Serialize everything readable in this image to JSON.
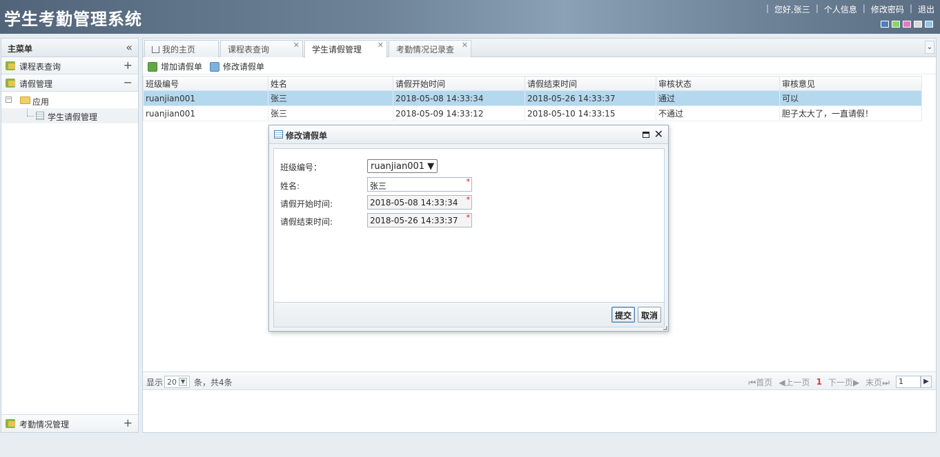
{
  "header": {
    "title": "学生考勤管理系统",
    "links": [
      "您好,张三",
      "个人信息",
      "修改密码",
      "退出"
    ],
    "theme_colors": [
      "#4a7fc1",
      "#8bd36a",
      "#e479c7",
      "#d9d9d9",
      "#8fc6e8"
    ]
  },
  "sidebar": {
    "title": "主菜单",
    "collapse_icon": "«",
    "panels": [
      {
        "label": "课程表查询",
        "tool": "+"
      },
      {
        "label": "请假管理",
        "tool": "−"
      }
    ],
    "tree": {
      "root": "应用",
      "child": "学生请假管理"
    },
    "bottom_panel": {
      "label": "考勤情况管理",
      "tool": "+"
    }
  },
  "tabs": [
    {
      "label": "我的主页",
      "closable": false
    },
    {
      "label": "课程表查询",
      "closable": true
    },
    {
      "label": "学生请假管理",
      "closable": true
    },
    {
      "label": "考勤情况记录查",
      "closable": true
    }
  ],
  "toolbar": {
    "add_label": "增加请假单",
    "edit_label": "修改请假单"
  },
  "grid": {
    "columns": [
      "班级编号",
      "姓名",
      "请假开始时间",
      "请假结束时间",
      "审核状态",
      "审核意见"
    ],
    "rows": [
      [
        "ruanjian001",
        "张三",
        "2018-05-08 14:33:34",
        "2018-05-26 14:33:37",
        "通过",
        "可以"
      ],
      [
        "ruanjian001",
        "张三",
        "2018-05-09 14:33:12",
        "2018-05-10 14:33:15",
        "不通过",
        "胆子太大了，一直请假！"
      ]
    ],
    "selected_row": 0
  },
  "pager": {
    "show_label": "显示",
    "page_size": "20",
    "summary": "条，共4条",
    "first": "首页",
    "prev": "上一页",
    "current": "1",
    "next": "下一页",
    "last": "末页",
    "page_input": "1"
  },
  "dialog": {
    "title": "修改请假单",
    "fields": {
      "class_label": "班级编号：",
      "class_value": "ruanjian001 ▼",
      "name_label": "姓名:",
      "name_value": "张三",
      "start_label": "请假开始时间:",
      "start_value": "2018-05-08 14:33:34",
      "end_label": "请假结束时间:",
      "end_value": "2018-05-26 14:33:37",
      "required_mark": "*"
    },
    "submit_label": "提交",
    "cancel_label": "取消"
  }
}
